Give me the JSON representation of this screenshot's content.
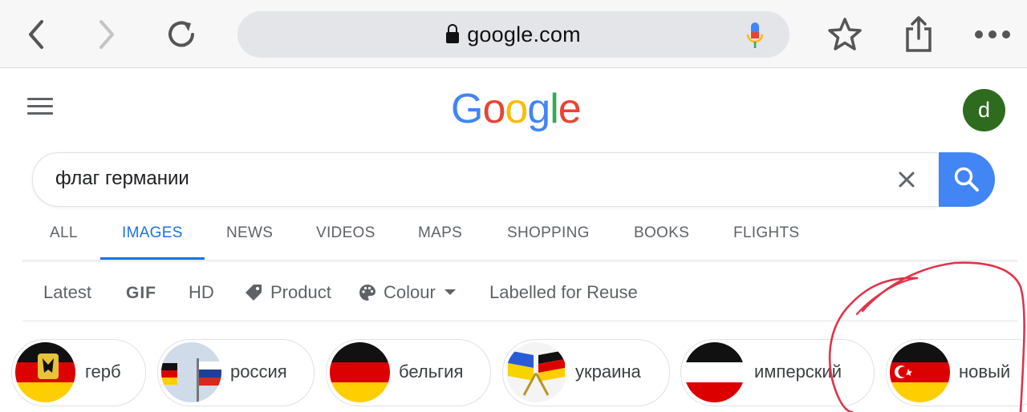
{
  "browser": {
    "url": "google.com",
    "icons": [
      "back-icon",
      "forward-icon",
      "reload-icon",
      "lock-icon",
      "mic-icon",
      "star-icon",
      "share-icon",
      "more-icon"
    ]
  },
  "header": {
    "logo_letters": [
      "G",
      "o",
      "o",
      "g",
      "l",
      "e"
    ],
    "logo_colors": [
      "#4285f4",
      "#ea4335",
      "#fbbc05",
      "#4285f4",
      "#34a853",
      "#ea4335"
    ],
    "avatar_letter": "d",
    "avatar_color": "#2e6b1f"
  },
  "search": {
    "query": "флаг германии",
    "button_color": "#4285f4"
  },
  "tabs": [
    "ALL",
    "IMAGES",
    "NEWS",
    "VIDEOS",
    "MAPS",
    "SHOPPING",
    "BOOKS",
    "FLIGHTS"
  ],
  "active_tab": "IMAGES",
  "filters": {
    "latest": "Latest",
    "gif": "GIF",
    "hd": "HD",
    "product": "Product",
    "colour": "Colour",
    "reuse": "Labelled for Reuse"
  },
  "chips": [
    "герб",
    "россия",
    "бельгия",
    "украина",
    "имперский",
    "новый"
  ],
  "colors": {
    "accent": "#1a73e8",
    "annotation": "#e0344a"
  }
}
